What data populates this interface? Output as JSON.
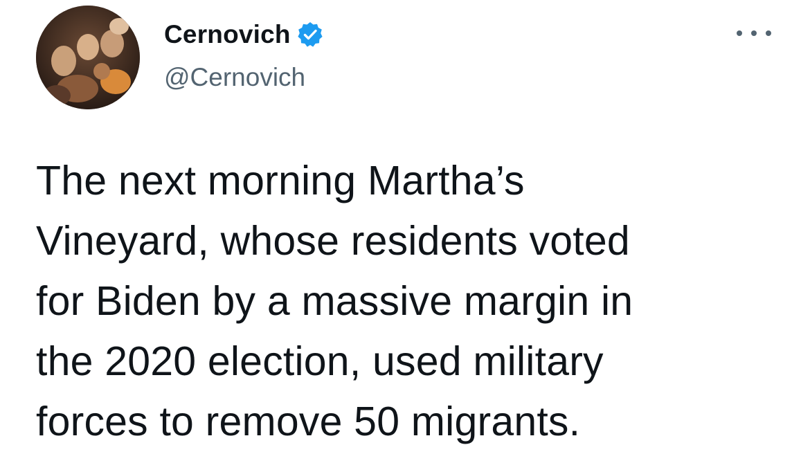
{
  "author": {
    "display_name": "Cernovich",
    "handle": "@Cernovich",
    "verified": true,
    "avatar_icon": "profile-photo",
    "verified_icon": "verified-badge-icon"
  },
  "menu": {
    "icon": "more-options-icon"
  },
  "tweet": {
    "lines": [
      "The next morning Martha’s",
      "Vineyard, whose residents voted",
      "for Biden by a massive margin in",
      "the 2020 election, used military",
      "forces to remove 50 migrants."
    ]
  },
  "colors": {
    "verified": "#1d9bf0",
    "text": "#0f1419",
    "secondary": "#536471"
  }
}
